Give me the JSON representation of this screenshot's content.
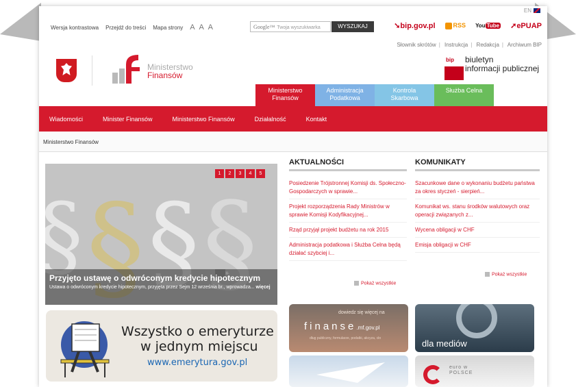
{
  "header": {
    "lang": "EN",
    "util_links": [
      "Wersja kontrastowa",
      "Przejdź do treści",
      "Mapa strony"
    ],
    "font_size_label": "A A A",
    "search_brand": "Google™",
    "search_placeholder": "Twoja wyszukiwarka",
    "search_button": "WYSZUKAJ",
    "bip_label": "bip.gov.pl",
    "rss_label": "RSS",
    "youtube_label": "You",
    "youtube_tube": "Tube",
    "epuap_label": "ePUAP",
    "top_links": [
      "Słownik skrótów",
      "Instrukcja",
      "Redakcja",
      "Archiwum BIP"
    ],
    "mf_line1": "Ministerstwo",
    "mf_line2": "Finansów",
    "bip_small": "bip",
    "bip_line1": "biuletyn",
    "bip_line2": "informacji publicznej"
  },
  "tabs": [
    {
      "l1": "Ministerstwo",
      "l2": "Finansów"
    },
    {
      "l1": "Administracja",
      "l2": "Podatkowa"
    },
    {
      "l1": "Kontrola",
      "l2": "Skarbowa"
    },
    {
      "l1": "Służba Celna",
      "l2": ""
    }
  ],
  "nav": [
    "Wiadomości",
    "Minister Finansów",
    "Ministerstwo Finansów",
    "Działalność",
    "Kontakt"
  ],
  "breadcrumb": "Ministerstwo Finansów",
  "slider": {
    "pages": [
      "1",
      "2",
      "3",
      "4",
      "5"
    ],
    "nav_prev": "<",
    "nav_next": ">",
    "nav_pause": "II",
    "nav_play": "►",
    "title": "Przyjęto ustawę o odwróconym kredycie hipotecznym",
    "desc": "Ustawa o odwróconym kredycie hipotecznym, przyjęta przez Sejm 12 września br., wprowadza...",
    "more": "więcej"
  },
  "emerytura": {
    "line1": "Wszystko o emeryturze",
    "line2": "w jednym miejscu",
    "url": "www.emerytura.gov.pl"
  },
  "aktualnosci": {
    "title": "AKTUALNOŚCI",
    "items": [
      "Posiedzenie Trójstronnej Komisji ds. Społeczno-Gospodarczych w sprawie...",
      "Projekt rozporządzenia Rady Ministrów w sprawie Komisji Kodyfikacyjnej...",
      "Rząd przyjął projekt budżetu na rok 2015",
      "Administracja podatkowa i Służba Celna będą działać szybciej i..."
    ],
    "show_all": "Pokaż wszystkie"
  },
  "komunikaty": {
    "title": "KOMUNIKATY",
    "items": [
      "Szacunkowe dane o wykonaniu budżetu państwa za okres styczeń - sierpień...",
      "Komunikat ws. stanu środków walutowych oraz operacji związanych z...",
      "Wycena obligacji w CHF",
      "Emisja obligacji w CHF"
    ],
    "show_all": "Pokaż wszystkie"
  },
  "banners": {
    "finanse_top": "dowiedz się więcej na",
    "finanse_mid": "finanse",
    "finanse_domain": ".mf.gov.pl",
    "finanse_sub": "dług publiczny, formularze, podatki, akcyza, cło",
    "media": "dla mediów",
    "euro_line1": "euro w",
    "euro_line2": "POLSCE"
  },
  "colors": {
    "brand_red": "#d51a2d",
    "tab_blue": "#7fb2e5",
    "tab_cyan": "#84c5e6",
    "tab_green": "#6abd5b"
  }
}
